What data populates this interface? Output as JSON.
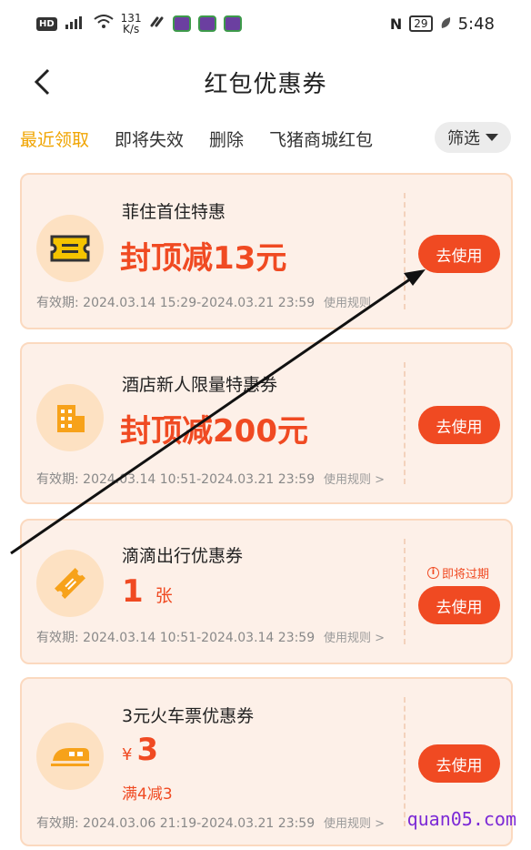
{
  "status_bar": {
    "hd": "HD",
    "net_top": "131",
    "net_bottom": "K/s",
    "battery": "29",
    "time": "5:48"
  },
  "header": {
    "title": "红包优惠券",
    "back_icon": "chevron-left-icon"
  },
  "tabs": [
    {
      "label": "最近领取",
      "active": true
    },
    {
      "label": "即将失效",
      "active": false
    },
    {
      "label": "删除",
      "active": false
    },
    {
      "label": "飞猪商城红包",
      "active": false
    }
  ],
  "filter": {
    "label": "筛选"
  },
  "coupons": [
    {
      "title": "菲住首住特惠",
      "amount": "封顶减13元",
      "validity": "有效期: 2024.03.14 15:29-2024.03.21 23:59",
      "rules": "使用规则",
      "button": "去使用",
      "icon": "ticket-icon"
    },
    {
      "title": "酒店新人限量特惠券",
      "amount": "封顶减200元",
      "validity": "有效期: 2024.03.14 10:51-2024.03.21 23:59",
      "rules": "使用规则 >",
      "button": "去使用",
      "icon": "building-icon"
    },
    {
      "title": "滴滴出行优惠券",
      "count": "1",
      "count_unit": "张",
      "validity": "有效期: 2024.03.14 10:51-2024.03.14 23:59",
      "rules": "使用规则 >",
      "expiring": "即将过期",
      "button": "去使用",
      "icon": "ticket-icon"
    },
    {
      "title": "3元火车票优惠券",
      "currency": "¥",
      "amount_value": "3",
      "condition": "满4减3",
      "validity": "有效期: 2024.03.06 21:19-2024.03.21 23:59",
      "rules": "使用规则 >",
      "button": "去使用",
      "icon": "train-icon"
    }
  ],
  "watermark": "quan05.com",
  "colors": {
    "accent": "#f04a22",
    "tab_active": "#f0a400",
    "card_bg": "#fdf0e8"
  }
}
